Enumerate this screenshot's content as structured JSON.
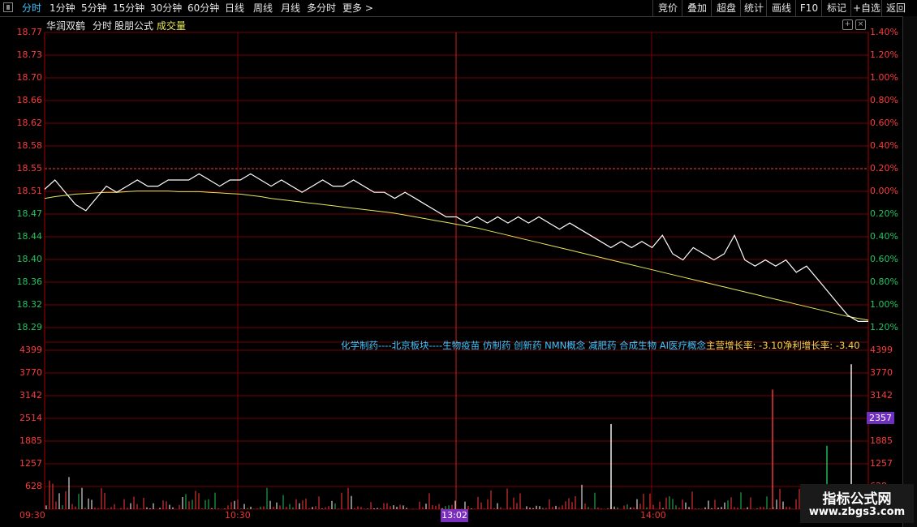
{
  "toolbar": {
    "periods": [
      "分时",
      "1分钟",
      "5分钟",
      "15分钟",
      "30分钟",
      "60分钟",
      "日线",
      "周线",
      "月线",
      "多分时",
      "更多 >"
    ],
    "active_period": "分时",
    "buttons": [
      "竞价",
      "叠加",
      "超盘",
      "统计",
      "画线",
      "F10",
      "标记",
      "+自选",
      "返回"
    ]
  },
  "title_row": {
    "stock_name": "华润双鹤",
    "chart_mode": "分时",
    "formula_label": "股朋公式",
    "indicator": "成交量"
  },
  "price_axis": {
    "left_labels": [
      "18.77",
      "18.73",
      "18.70",
      "18.66",
      "18.62",
      "18.58",
      "18.55",
      "18.51",
      "18.47",
      "18.44",
      "18.40",
      "18.36",
      "18.32",
      "18.29"
    ],
    "right_labels": [
      "1.40%",
      "1.20%",
      "1.00%",
      "0.80%",
      "0.60%",
      "0.40%",
      "0.20%",
      "0.00%",
      "0.20%",
      "0.40%",
      "0.60%",
      "0.80%",
      "1.00%",
      "1.20%"
    ]
  },
  "volume_axis": {
    "labels": [
      "4399",
      "3770",
      "3142",
      "2514",
      "1885",
      "1257",
      "628"
    ],
    "current_value": "2357"
  },
  "time_axis": {
    "labels": [
      "09:30",
      "10:30",
      "14:00"
    ],
    "cursor_label": "13:02"
  },
  "info_line": {
    "concepts": "化学制药----北京板块----生物疫苗 仿制药 创新药 NMN概念 减肥药 合成生物 AI医疗概念",
    "revenue_growth": "主营增长率: -3.10",
    "profit_growth": "净利增长率: -3.40"
  },
  "watermark": {
    "title": "指标公式网",
    "url": "www.zbgs3.com"
  },
  "colors": {
    "up": "#ff3b3b",
    "down": "#22c55e",
    "price_line": "#ffffff",
    "avg_line": "#e8e85a",
    "grid": "#8b0000"
  },
  "chart_data": {
    "type": "line",
    "title": "华润双鹤",
    "ylim": [
      18.29,
      18.77
    ],
    "x": [
      0,
      3,
      6,
      9,
      12,
      15,
      18,
      21,
      24,
      27,
      30,
      33,
      36,
      39,
      42,
      45,
      48,
      51,
      54,
      57,
      60,
      63,
      66,
      69,
      72,
      75,
      78,
      81,
      84,
      87,
      90,
      93,
      96,
      99,
      102,
      105,
      108,
      111,
      114,
      117,
      120,
      123,
      126,
      129,
      132,
      135,
      138,
      141,
      144,
      147,
      150,
      153,
      156,
      159,
      162,
      165,
      168,
      171,
      174,
      177,
      180,
      183,
      186,
      189,
      192,
      195,
      198,
      201,
      204,
      207,
      210,
      213,
      216,
      219,
      222,
      225,
      228,
      231,
      234,
      237,
      240
    ],
    "series": [
      {
        "values": [
          18.515,
          18.53,
          18.51,
          18.49,
          18.48,
          18.5,
          18.52,
          18.51,
          18.52,
          18.53,
          18.52,
          18.52,
          18.53,
          18.53,
          18.53,
          18.54,
          18.53,
          18.52,
          18.53,
          18.53,
          18.54,
          18.53,
          18.52,
          18.53,
          18.52,
          18.51,
          18.52,
          18.53,
          18.52,
          18.52,
          18.53,
          18.52,
          18.51,
          18.51,
          18.5,
          18.51,
          18.5,
          18.49,
          18.48,
          18.47,
          18.47,
          18.46,
          18.47,
          18.46,
          18.47,
          18.46,
          18.47,
          18.46,
          18.47,
          18.46,
          18.45,
          18.46,
          18.45,
          18.44,
          18.43,
          18.42,
          18.43,
          18.42,
          18.43,
          18.42,
          18.44,
          18.41,
          18.4,
          18.42,
          18.41,
          18.4,
          18.41,
          18.44,
          18.4,
          18.39,
          18.4,
          18.39,
          18.4,
          18.38,
          18.39,
          18.37,
          18.35,
          18.33,
          18.31,
          18.3,
          18.3
        ]
      },
      {
        "values": [
          18.5,
          18.503,
          18.505,
          18.507,
          18.508,
          18.509,
          18.51,
          18.51,
          18.511,
          18.512,
          18.512,
          18.512,
          18.512,
          18.511,
          18.511,
          18.511,
          18.51,
          18.509,
          18.508,
          18.507,
          18.505,
          18.503,
          18.5,
          18.498,
          18.496,
          18.494,
          18.492,
          18.49,
          18.488,
          18.486,
          18.484,
          18.482,
          18.48,
          18.478,
          18.476,
          18.473,
          18.47,
          18.467,
          18.464,
          18.461,
          18.458,
          18.455,
          18.452,
          18.448,
          18.444,
          18.44,
          18.436,
          18.432,
          18.428,
          18.424,
          18.42,
          18.416,
          18.412,
          18.408,
          18.404,
          18.4,
          18.396,
          18.392,
          18.388,
          18.384,
          18.38,
          18.376,
          18.372,
          18.368,
          18.364,
          18.36,
          18.356,
          18.352,
          18.348,
          18.344,
          18.34,
          18.336,
          18.332,
          18.328,
          18.324,
          18.32,
          18.316,
          18.312,
          18.308,
          18.305,
          18.302
        ]
      }
    ]
  }
}
